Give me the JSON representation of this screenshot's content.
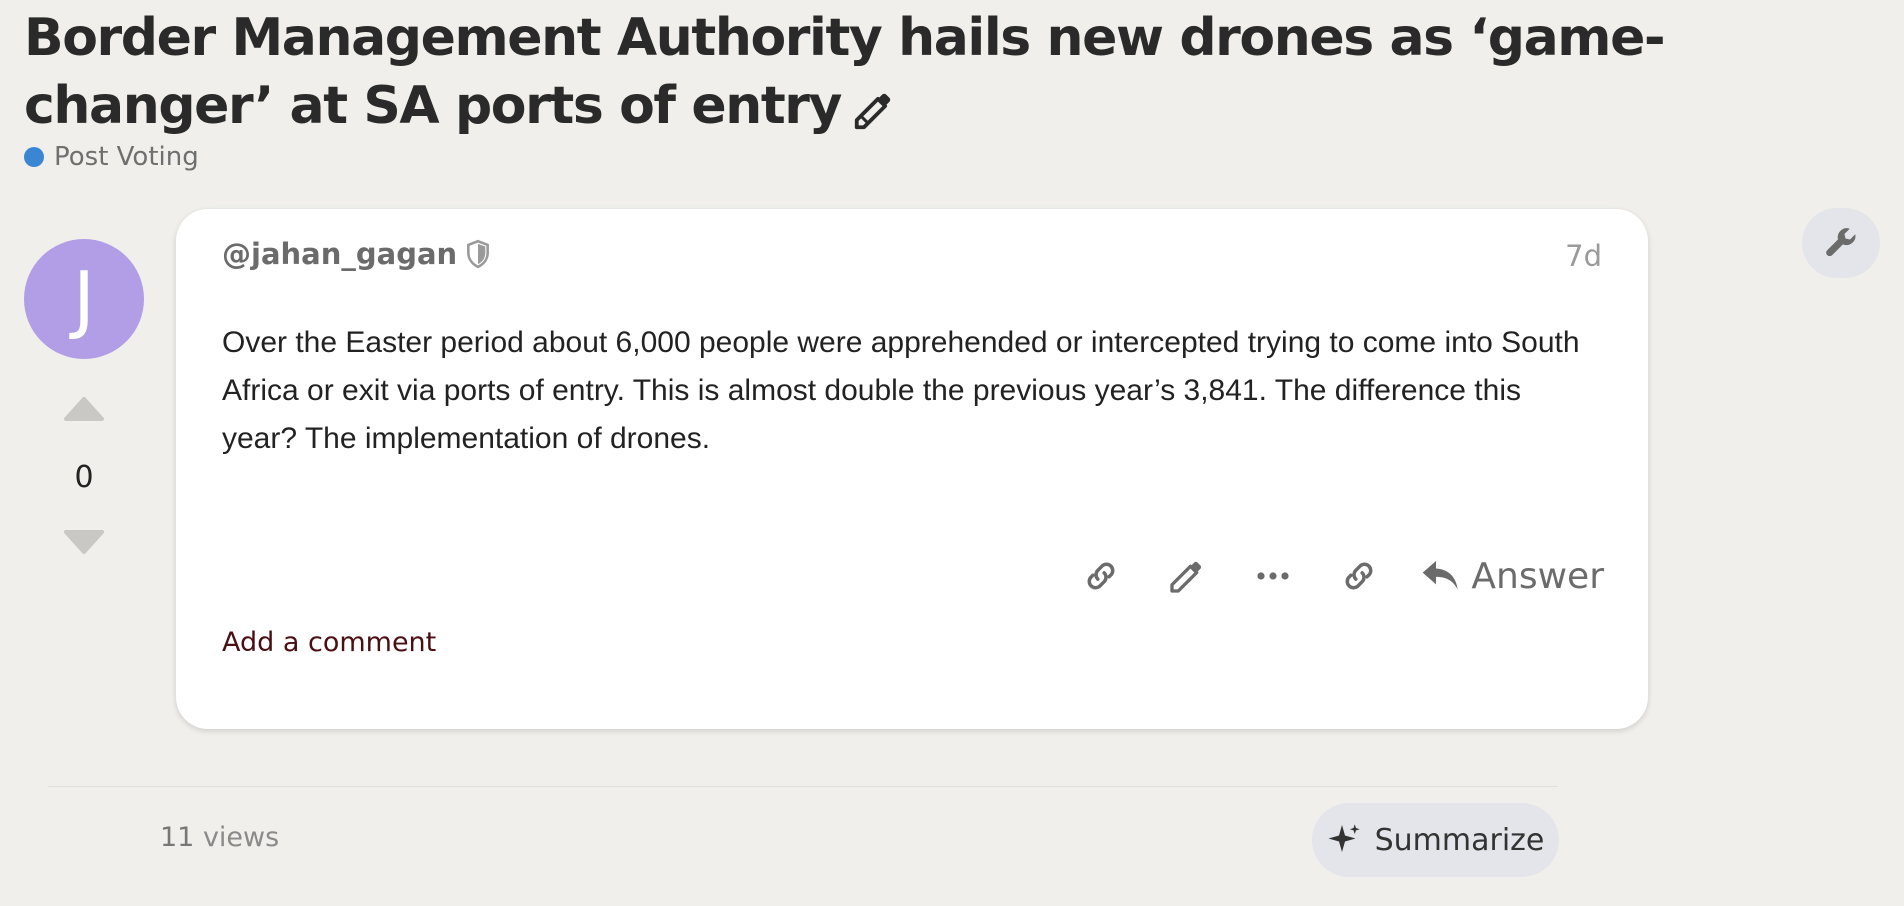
{
  "topic": {
    "title": "Border Management Authority hails new drones as ‘game-changer’ at SA ports of entry",
    "edit_icon": "pencil-icon"
  },
  "category": {
    "name": "Post Voting",
    "color": "#3b86d3"
  },
  "post": {
    "avatar_letter": "J",
    "avatar_color": "#b29ee6",
    "username": "@jahan_gagan",
    "user_badge_icon": "shield-icon",
    "date": "7d",
    "body": "Over the Easter period about 6,000 people were apprehended or intercepted trying to come into South Africa or exit via ports of entry. This is almost double the previous year’s 3,841. The difference this year? The implementation of drones.",
    "vote_count": "0",
    "actions": [
      {
        "icon": "link-icon"
      },
      {
        "icon": "pencil-icon"
      },
      {
        "icon": "more-icon"
      },
      {
        "icon": "link-icon"
      }
    ],
    "answer_label": "Answer",
    "add_comment_label": "Add a comment"
  },
  "admin": {
    "wrench_icon": "wrench-icon"
  },
  "footer": {
    "views_count": "11",
    "views_label": "views",
    "summarize_label": "Summarize"
  }
}
